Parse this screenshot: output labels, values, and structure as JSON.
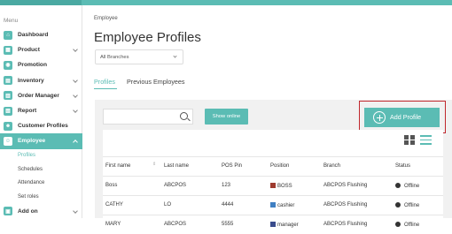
{
  "sidebar": {
    "menu_label": "Menu",
    "items": [
      {
        "label": "Dashboard",
        "icon": "dashboard-icon",
        "glyph": "⌂",
        "expandable": false
      },
      {
        "label": "Product",
        "icon": "product-icon",
        "glyph": "▦",
        "expandable": true
      },
      {
        "label": "Promotion",
        "icon": "promotion-icon",
        "glyph": "◉",
        "expandable": false
      },
      {
        "label": "Inventory",
        "icon": "inventory-icon",
        "glyph": "▤",
        "expandable": true
      },
      {
        "label": "Order Manager",
        "icon": "order-manager-icon",
        "glyph": "▥",
        "expandable": true
      },
      {
        "label": "Report",
        "icon": "report-icon",
        "glyph": "▧",
        "expandable": true
      },
      {
        "label": "Customer Profiles",
        "icon": "customer-profiles-icon",
        "glyph": "☻",
        "expandable": false
      },
      {
        "label": "Employee",
        "icon": "employee-icon",
        "glyph": "☺",
        "expandable": true
      }
    ],
    "employee_sub": [
      "Profiles",
      "Schedules",
      "Attendance",
      "Set roles"
    ],
    "addon": {
      "label": "Add on",
      "glyph": "▣"
    }
  },
  "main": {
    "breadcrumb": "Employee",
    "title": "Employee Profiles",
    "branch_select": "All Branches",
    "tabs": [
      "Profiles",
      "Previous Employees"
    ],
    "show_online": "Show online",
    "add_profile": "Add Profile",
    "search_placeholder": ""
  },
  "table": {
    "columns": [
      "First name",
      "Last name",
      "POS Pin",
      "Position",
      "Branch",
      "Status"
    ],
    "rows": [
      {
        "first": "Boss",
        "last": "ABCPOS",
        "pin": "123",
        "position": "BOSS",
        "position_color": "#9e3b2f",
        "branch": "ABCPOS Flushing",
        "status": "Offline"
      },
      {
        "first": "CATHY",
        "last": "LO",
        "pin": "4444",
        "position": "cashier",
        "position_color": "#3f7fc2",
        "branch": "ABCPOS Flushing",
        "status": "Offline"
      },
      {
        "first": "MARY",
        "last": "ABCPOS",
        "pin": "5555",
        "position": "manager",
        "position_color": "#3a4c8c",
        "branch": "ABCPOS Flushing",
        "status": "Offline"
      }
    ]
  },
  "colors": {
    "accent": "#5bbcb4",
    "highlight_outline": "#c0272d"
  }
}
